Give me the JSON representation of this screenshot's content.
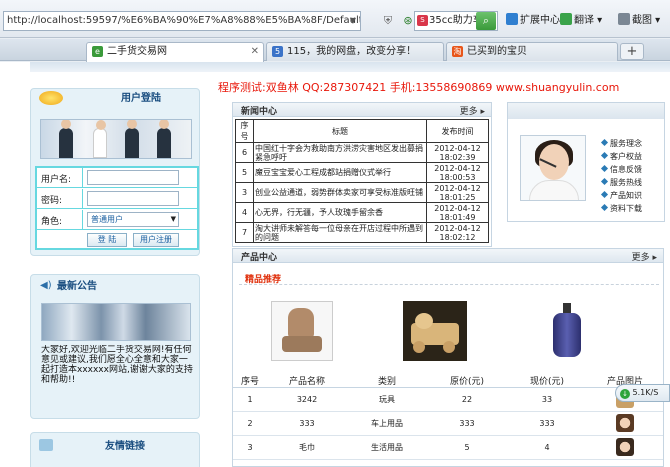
{
  "browser": {
    "url": "http://localhost:59597/%E6%BA%90%E7%A8%88%E5%BA%8F/Default.aspx",
    "search_value": "35cc助力车",
    "toolbar": {
      "extensions": "扩展中心",
      "translate": "翻译",
      "screenshot": "截图"
    },
    "tabs": [
      {
        "label": "二手货交易网"
      },
      {
        "label": "115，我的网盘，改变分享！"
      },
      {
        "label": "已买到的宝贝"
      }
    ]
  },
  "banner": "程序测试:双鱼林 QQ:287307421 手机:13558690869 www.shuangyulin.com",
  "login": {
    "title": "用户登陆",
    "username_label": "用户名:",
    "password_label": "密码:",
    "role_label": "角色:",
    "role_selected": "普通用户",
    "login_button": "登 陆",
    "register_button": "用户注册"
  },
  "notice": {
    "title": "最新公告",
    "text": "大家好,欢迎光临二手货交易网!有任何意见或建议,我们愿全心全意和大家一起打造本xxxxxx网站,谢谢大家的支持和帮助!!"
  },
  "friend_links": {
    "title": "友情链接"
  },
  "news": {
    "title": "新闻中心",
    "more": "更多",
    "headers": [
      "序号",
      "标题",
      "发布时间"
    ],
    "rows": [
      {
        "id": "6",
        "title": "中国红十字会为救助南方洪涝灾害地区发出募捐紧急呼吁",
        "date": "2012-04-12",
        "time": "18:02:39"
      },
      {
        "id": "5",
        "title": "魔豆宝宝爱心工程成都站捐赠仪式举行",
        "date": "2012-04-12",
        "time": "18:00:53"
      },
      {
        "id": "3",
        "title": "创业公益通道，弱势群体卖家可享受标准版旺铺",
        "date": "2012-04-12",
        "time": "18:01:25"
      },
      {
        "id": "4",
        "title": "心无界，行无疆，予人玫瑰手留余香",
        "date": "2012-04-12",
        "time": "18:01:49"
      },
      {
        "id": "7",
        "title": "淘大讲师未解答每一位母亲在开店过程中所遇到的问题",
        "date": "2012-04-12",
        "time": "18:02:12"
      }
    ]
  },
  "products": {
    "title": "产品中心",
    "more": "更多",
    "recommend_title": "精品推荐",
    "headers": [
      "序号",
      "产品名称",
      "类别",
      "原价(元)",
      "现价(元)",
      "产品图片"
    ],
    "rows": [
      {
        "id": "1",
        "name": "3242",
        "category": "玩具",
        "original": "22",
        "current": "33"
      },
      {
        "id": "2",
        "name": "333",
        "category": "车上用品",
        "original": "333",
        "current": "333"
      },
      {
        "id": "3",
        "name": "毛巾",
        "category": "生活用品",
        "original": "5",
        "current": "4"
      }
    ]
  },
  "service": {
    "links": [
      "服务理念",
      "客户权益",
      "信息反馈",
      "服务热线",
      "产品知识",
      "资料下载"
    ]
  },
  "speed_indicator": "5.1K/S"
}
